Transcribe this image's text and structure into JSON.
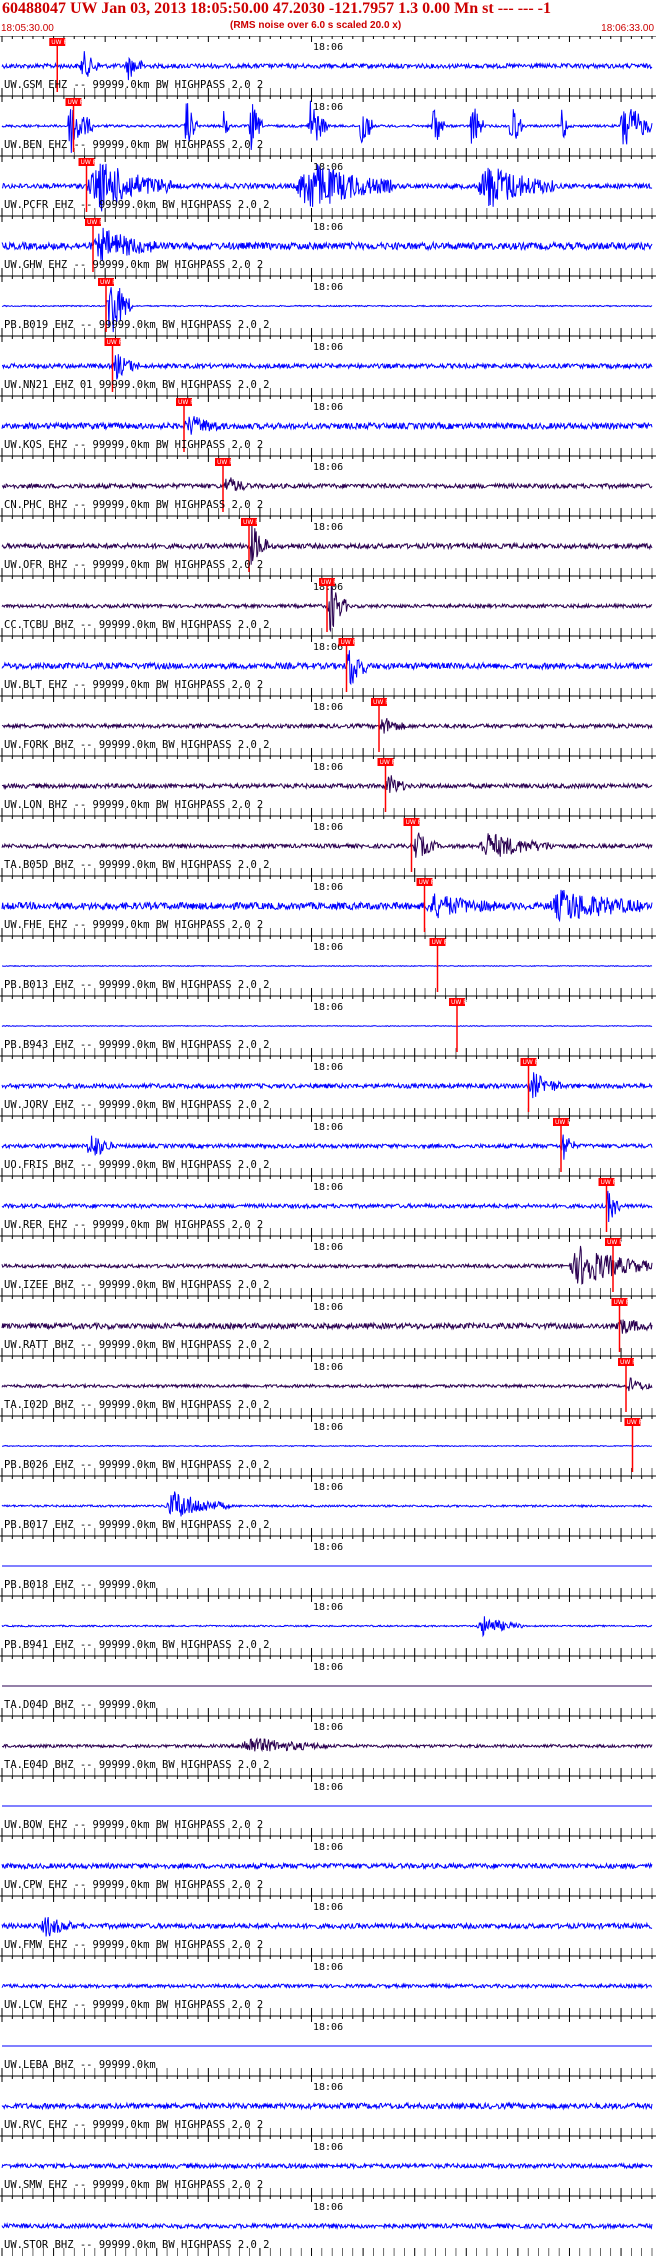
{
  "header": {
    "event_line": "60488047 UW Jan 03, 2013 18:05:50.00   47.2030 -121.7957  1.3 0.00 Mn st --- --- -1",
    "start_time": "18:05:30.00",
    "end_time": "18:06:33.00",
    "rms_note": "(RMS noise over 6.0 s scaled 20.0 x)"
  },
  "chart_data": {
    "type": "line",
    "title": "60488047 UW Jan 03, 2013 18:05:50.00   47.2030 -121.7957  1.3 0.00 Mn st --- --- -1",
    "x_range": [
      "18:05:30.00",
      "18:06:33.00"
    ],
    "time_tick_label": "18:06",
    "grid": false,
    "pick_label": "UW P",
    "colors": {
      "blue": "#0000ff",
      "dark": "#2a0050",
      "pick": "#ff0000"
    },
    "traces": [
      {
        "label": "UW.GSM EHZ -- 99999.0km BW  HIGHPASS  2.0  2",
        "color": "blue",
        "pick": 0.085,
        "amp": 0.45,
        "bursts": [
          [
            0.12,
            0.15,
            3.0
          ],
          [
            0.19,
            0.22,
            2.5
          ]
        ]
      },
      {
        "label": "UW.BEN EHZ -- 99999.0km BW  HIGHPASS  2.0  2",
        "color": "blue",
        "pick": 0.11,
        "amp": 0.25,
        "bursts": [
          [
            0.1,
            0.14,
            6.0
          ],
          [
            0.28,
            0.3,
            6.0
          ],
          [
            0.34,
            0.35,
            6.0
          ],
          [
            0.38,
            0.4,
            6.0
          ],
          [
            0.47,
            0.5,
            6.0
          ],
          [
            0.55,
            0.57,
            6.0
          ],
          [
            0.66,
            0.68,
            6.0
          ],
          [
            0.72,
            0.74,
            6.0
          ],
          [
            0.78,
            0.8,
            6.0
          ],
          [
            0.86,
            0.87,
            6.0
          ],
          [
            0.95,
            1.0,
            6.0
          ]
        ]
      },
      {
        "label": "UW.PCFR EHZ -- 99999.0km BW  HIGHPASS  2.0  2",
        "color": "blue",
        "pick": 0.13,
        "amp": 0.5,
        "bursts": [
          [
            0.13,
            0.26,
            5.0
          ],
          [
            0.45,
            0.6,
            5.0
          ],
          [
            0.73,
            0.85,
            4.5
          ]
        ]
      },
      {
        "label": "UW.GHW EHZ -- 99999.0km BW  HIGHPASS  2.0  2",
        "color": "blue",
        "pick": 0.14,
        "amp": 0.7,
        "bursts": [
          [
            0.14,
            0.24,
            3.0
          ]
        ]
      },
      {
        "label": "PB.B019 EHZ -- 99999.0km BW  HIGHPASS  2.0  2",
        "color": "blue",
        "pick": 0.16,
        "amp": 0.12,
        "bursts": [
          [
            0.16,
            0.2,
            8.0
          ]
        ]
      },
      {
        "label": "UW.NN21 EHZ 01 99999.0km BW  HIGHPASS  2.0  2",
        "color": "blue",
        "pick": 0.17,
        "amp": 0.45,
        "bursts": [
          [
            0.17,
            0.21,
            2.5
          ]
        ]
      },
      {
        "label": "UW.KOS EHZ -- 99999.0km BW  HIGHPASS  2.0  2",
        "color": "blue",
        "pick": 0.28,
        "amp": 0.6,
        "bursts": [
          [
            0.28,
            0.34,
            1.8
          ]
        ]
      },
      {
        "label": "CN.PHC BHZ -- 99999.0km BW  HIGHPASS  2.0  2",
        "color": "dark",
        "pick": 0.34,
        "amp": 0.45,
        "bursts": [
          [
            0.34,
            0.38,
            1.8
          ]
        ]
      },
      {
        "label": "UW.OFR BHZ -- 99999.0km BW  HIGHPASS  2.0  2",
        "color": "dark",
        "pick": 0.38,
        "amp": 0.5,
        "bursts": [
          [
            0.38,
            0.41,
            4.5
          ]
        ]
      },
      {
        "label": "CC.TCBU BHZ -- 99999.0km BW  HIGHPASS  2.0  2",
        "color": "dark",
        "pick": 0.5,
        "amp": 0.35,
        "bursts": [
          [
            0.5,
            0.53,
            6.0
          ]
        ]
      },
      {
        "label": "UW.BLT EHZ -- 99999.0km BW  HIGHPASS  2.0  2",
        "color": "blue",
        "pick": 0.53,
        "amp": 0.6,
        "bursts": [
          [
            0.53,
            0.56,
            5.0
          ]
        ]
      },
      {
        "label": "UW.FORK BHZ -- 99999.0km BW  HIGHPASS  2.0  2",
        "color": "dark",
        "pick": 0.58,
        "amp": 0.4,
        "bursts": [
          [
            0.58,
            0.62,
            1.8
          ]
        ]
      },
      {
        "label": "UW.LON BHZ -- 99999.0km BW  HIGHPASS  2.0  2",
        "color": "dark",
        "pick": 0.59,
        "amp": 0.45,
        "bursts": [
          [
            0.59,
            0.62,
            2.5
          ]
        ]
      },
      {
        "label": "TA.B05D BHZ -- 99999.0km BW  HIGHPASS  2.0  2",
        "color": "dark",
        "pick": 0.63,
        "amp": 0.4,
        "bursts": [
          [
            0.63,
            0.67,
            3.0
          ],
          [
            0.73,
            0.85,
            2.5
          ]
        ]
      },
      {
        "label": "UW.FHE EHZ -- 99999.0km BW  HIGHPASS  2.0  2",
        "color": "blue",
        "pick": 0.65,
        "amp": 0.7,
        "bursts": [
          [
            0.65,
            0.76,
            2.0
          ],
          [
            0.84,
            0.99,
            3.0
          ]
        ]
      },
      {
        "label": "PB.B013 EHZ -- 99999.0km BW  HIGHPASS  2.0  2",
        "color": "blue",
        "pick": 0.67,
        "amp": 0.08,
        "bursts": []
      },
      {
        "label": "PB.B943 EHZ -- 99999.0km BW  HIGHPASS  2.0  2",
        "color": "blue",
        "pick": 0.7,
        "amp": 0.08,
        "bursts": []
      },
      {
        "label": "UW.JORV EHZ -- 99999.0km BW  HIGHPASS  2.0  2",
        "color": "blue",
        "pick": 0.81,
        "amp": 0.45,
        "bursts": [
          [
            0.81,
            0.86,
            2.5
          ]
        ]
      },
      {
        "label": "UO.FRIS BHZ -- 99999.0km BW  HIGHPASS  2.0  2",
        "color": "blue",
        "pick": 0.86,
        "amp": 0.4,
        "bursts": [
          [
            0.13,
            0.17,
            3.0
          ],
          [
            0.86,
            0.88,
            3.5
          ]
        ]
      },
      {
        "label": "UW.RER EHZ -- 99999.0km BW  HIGHPASS  2.0  2",
        "color": "blue",
        "pick": 0.93,
        "amp": 0.4,
        "bursts": [
          [
            0.93,
            0.95,
            4.0
          ]
        ]
      },
      {
        "label": "UW.IZEE BHZ -- 99999.0km BW  HIGHPASS  2.0  2",
        "color": "dark",
        "pick": 0.94,
        "amp": 0.35,
        "bursts": [
          [
            0.87,
            1.0,
            4.0
          ]
        ]
      },
      {
        "label": "UW.RATT BHZ -- 99999.0km BW  HIGHPASS  2.0  2",
        "color": "dark",
        "pick": 0.95,
        "amp": 0.55,
        "bursts": [
          [
            0.94,
            1.0,
            1.5
          ]
        ]
      },
      {
        "label": "TA.I02D BHZ -- 99999.0km BW  HIGHPASS  2.0  2",
        "color": "dark",
        "pick": 0.96,
        "amp": 0.3,
        "bursts": [
          [
            0.96,
            1.0,
            1.5
          ]
        ]
      },
      {
        "label": "PB.B026 EHZ -- 99999.0km BW  HIGHPASS  2.0  2",
        "color": "blue",
        "pick": 0.97,
        "amp": 0.1,
        "bursts": []
      },
      {
        "label": "PB.B017 EHZ -- 99999.0km BW  HIGHPASS  2.0  2",
        "color": "blue",
        "pick": null,
        "amp": 0.2,
        "bursts": [
          [
            0.25,
            0.35,
            3.0
          ]
        ]
      },
      {
        "label": "PB.B018 EHZ -- 99999.0km",
        "color": "blue",
        "pick": null,
        "amp": 0.0,
        "bursts": []
      },
      {
        "label": "PB.B941 EHZ -- 99999.0km BW  HIGHPASS  2.0  2",
        "color": "blue",
        "pick": null,
        "amp": 0.15,
        "bursts": [
          [
            0.73,
            0.8,
            2.0
          ]
        ]
      },
      {
        "label": "TA.D04D BHZ -- 99999.0km",
        "color": "dark",
        "pick": null,
        "amp": 0.0,
        "bursts": []
      },
      {
        "label": "TA.E04D BHZ -- 99999.0km BW  HIGHPASS  2.0  2",
        "color": "dark",
        "pick": null,
        "amp": 0.3,
        "bursts": [
          [
            0.36,
            0.5,
            1.6
          ]
        ]
      },
      {
        "label": "UW.BOW EHZ -- 99999.0km BW  HIGHPASS  2.0  2",
        "color": "blue",
        "pick": null,
        "amp": 0.0,
        "bursts": []
      },
      {
        "label": "UW.CPW EHZ -- 99999.0km BW  HIGHPASS  2.0  2",
        "color": "blue",
        "pick": null,
        "amp": 0.5,
        "bursts": []
      },
      {
        "label": "UW.FMW EHZ -- 99999.0km BW  HIGHPASS  2.0  2",
        "color": "blue",
        "pick": null,
        "amp": 0.5,
        "bursts": [
          [
            0.06,
            0.11,
            2.0
          ]
        ]
      },
      {
        "label": "UW.LCW EHZ -- 99999.0km BW  HIGHPASS  2.0  2",
        "color": "blue",
        "pick": null,
        "amp": 0.35,
        "bursts": []
      },
      {
        "label": "UW.LEBA BHZ -- 99999.0km",
        "color": "blue",
        "pick": null,
        "amp": 0.0,
        "bursts": []
      },
      {
        "label": "UW.RVC EHZ -- 99999.0km BW  HIGHPASS  2.0  2",
        "color": "blue",
        "pick": null,
        "amp": 0.55,
        "bursts": []
      },
      {
        "label": "UW.SMW EHZ -- 99999.0km BW  HIGHPASS  2.0  2",
        "color": "blue",
        "pick": null,
        "amp": 0.45,
        "bursts": []
      },
      {
        "label": "UW.STOR BHZ -- 99999.0km BW  HIGHPASS  2.0  2",
        "color": "blue",
        "pick": null,
        "amp": 0.45,
        "bursts": []
      }
    ]
  }
}
